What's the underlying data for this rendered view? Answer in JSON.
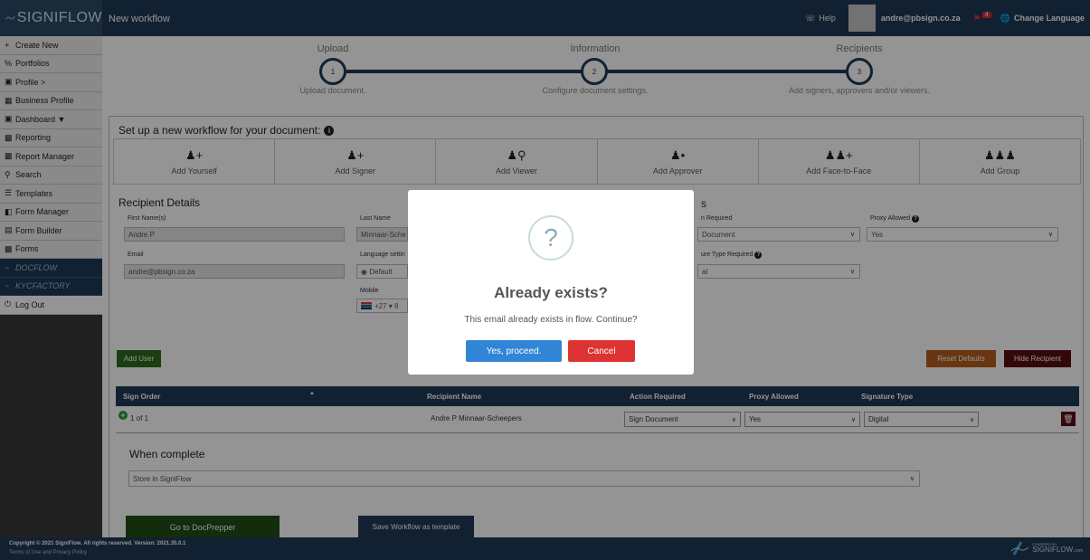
{
  "header": {
    "logo_text": "SIGNIFLOW",
    "page_title": "New workflow",
    "help_label": "Help",
    "username": "andre@pbsign.co.za",
    "notification_count": "4",
    "change_language": "Change Language"
  },
  "sidebar": {
    "items": [
      {
        "label": "Create New",
        "icon": "plus-icon"
      },
      {
        "label": "Portfolios",
        "icon": "link-icon"
      },
      {
        "label": "Profile >",
        "icon": "plus-square-icon"
      },
      {
        "label": "Business Profile",
        "icon": "building-icon"
      },
      {
        "label": "Dashboard",
        "icon": "plus-square-icon"
      },
      {
        "label": "Reporting",
        "icon": "chart-icon"
      },
      {
        "label": "Report Manager",
        "icon": "chart-icon"
      },
      {
        "label": "Search",
        "icon": "search-icon"
      },
      {
        "label": "Templates",
        "icon": "list-icon"
      },
      {
        "label": "Form Manager",
        "icon": "copy-icon"
      },
      {
        "label": "Form Builder",
        "icon": "form-icon"
      },
      {
        "label": "Forms",
        "icon": "chart-icon"
      },
      {
        "label": "DOCFLOW",
        "icon": "docflow-logo"
      },
      {
        "label": "KYCFACTORY",
        "icon": "kyc-logo"
      },
      {
        "label": "Log Out",
        "icon": "power-icon"
      }
    ]
  },
  "stepper": {
    "steps": [
      {
        "title": "Upload",
        "number": "1",
        "subtitle": "Upload document."
      },
      {
        "title": "Information",
        "number": "2",
        "subtitle": "Configure document settings."
      },
      {
        "title": "Recipients",
        "number": "3",
        "subtitle": "Add signers, approvers and/or viewers."
      }
    ]
  },
  "workflow": {
    "heading": "Set up a new workflow for your document:",
    "add_options": [
      {
        "label": "Add Yourself",
        "icon": "user-plus-icon"
      },
      {
        "label": "Add Signer",
        "icon": "user-plus-icon"
      },
      {
        "label": "Add Viewer",
        "icon": "user-search-icon"
      },
      {
        "label": "Add Approver",
        "icon": "user-check-icon"
      },
      {
        "label": "Add Face-to-Face",
        "icon": "users-plus-icon"
      },
      {
        "label": "Add Group",
        "icon": "users-icon"
      }
    ]
  },
  "recipient": {
    "title": "Recipient Details",
    "first_name_label": "First Name(s)",
    "first_name_value": "Andre P",
    "last_name_label": "Last Name",
    "last_name_value": "Minnaar-Sche",
    "email_label": "Email",
    "email_value": "andre@pbsign.co.za",
    "language_label": "Language settin",
    "language_value": "Default",
    "mobile_label": "Mobile",
    "mobile_code": "+27",
    "mobile_value": "8",
    "right_title_fragment": "s",
    "action_label": "n Required",
    "action_value": "Document",
    "sig_type_label": "ure Type Required",
    "sig_type_value": "al",
    "proxy_label": "Proxy Allowed",
    "proxy_value": "Yes"
  },
  "buttons": {
    "add_user": "Add User",
    "reset_defaults": "Reset Defaults",
    "hide_recipient": "Hide Recipient",
    "go_docprepper": "Go to DocPrepper",
    "save_template": "Save Workflow as template"
  },
  "table": {
    "headers": [
      "Sign Order",
      "Recipient Name",
      "Action Required",
      "Proxy Allowed",
      "Signature Type"
    ],
    "row": {
      "order": "1 of 1",
      "name": "Andre P Minnaar-Scheepers",
      "action": "Sign Document",
      "proxy": "Yes",
      "signature": "Digital"
    }
  },
  "completion": {
    "title": "When complete",
    "value": "Store in SigniFlow"
  },
  "footer": {
    "copyright": "Copyright © 2021 SigniFlow. All rights reserved. Version: 2021.35.0.1",
    "terms": "Terms of Use and Privacy Policy",
    "powered_by": "POWERED BY",
    "powered_brand": "SIGNIFLOW",
    "powered_suffix": ".com"
  },
  "modal": {
    "icon": "?",
    "title": "Already exists?",
    "text": "This email already exists in flow. Continue?",
    "confirm": "Yes, proceed.",
    "cancel": "Cancel"
  }
}
